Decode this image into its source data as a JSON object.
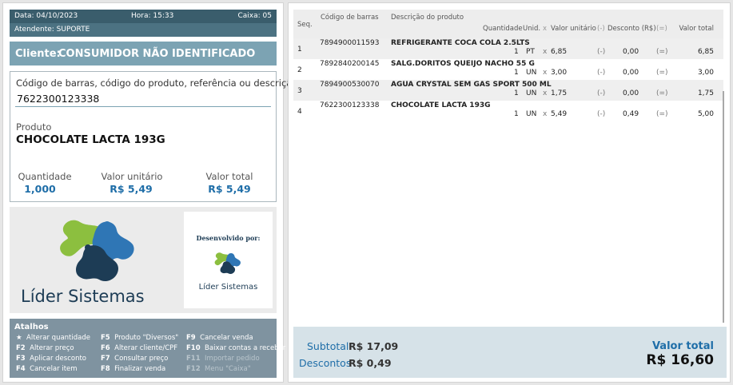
{
  "info": {
    "data": "Data:  04/10/2023",
    "hora": "Hora:  15:33",
    "caixa": "Caixa: 05",
    "atendente": "Atendente:  SUPORTE"
  },
  "client": {
    "label": "Cliente:",
    "name": "CONSUMIDOR NÃO IDENTIFICADO"
  },
  "entry": {
    "label": "Código de barras, código do produto, referência ou descrição",
    "value": "7622300123338",
    "produto_label": "Produto",
    "produto_name": "CHOCOLATE LACTA 193G",
    "qty_label": "Quantidade",
    "qty_value": "1,000",
    "vu_label": "Valor unitário",
    "vu_value": "R$ 5,49",
    "vt_label": "Valor total",
    "vt_value": "R$ 5,49"
  },
  "brand": {
    "dev_by": "Desenvolvido por:",
    "name": "Líder Sistemas",
    "colors": {
      "green": "#8cbf3f",
      "blue": "#2f76b5",
      "navy": "#1d3c55"
    }
  },
  "shortcuts": {
    "title": "Atalhos",
    "items": [
      {
        "key": "★",
        "label": "Alterar quantidade",
        "enabled": true
      },
      {
        "key": "F2",
        "label": "Alterar preço",
        "enabled": true
      },
      {
        "key": "F3",
        "label": "Aplicar desconto",
        "enabled": true
      },
      {
        "key": "F4",
        "label": "Cancelar item",
        "enabled": true
      },
      {
        "key": "F5",
        "label": "Produto \"Diversos\"",
        "enabled": true
      },
      {
        "key": "F6",
        "label": "Alterar cliente/CPF",
        "enabled": true
      },
      {
        "key": "F7",
        "label": "Consultar preço",
        "enabled": true
      },
      {
        "key": "F8",
        "label": "Finalizar venda",
        "enabled": true
      },
      {
        "key": "F9",
        "label": "Cancelar venda",
        "enabled": true
      },
      {
        "key": "F10",
        "label": "Baixar contas a receber",
        "enabled": true
      },
      {
        "key": "F11",
        "label": "Importar pedido",
        "enabled": false
      },
      {
        "key": "F12",
        "label": "Menu \"Caixa\"",
        "enabled": false
      }
    ]
  },
  "table": {
    "headers": {
      "seq": "Seq.",
      "barcode": "Código de barras",
      "desc": "Descrição do produto",
      "qty": "Quantidade",
      "unit": "Unid.",
      "x": "x",
      "vu": "Valor unitário",
      "minus": "(-)",
      "discount": "Desconto (R$)",
      "equals": "(=)",
      "total": "Valor total"
    },
    "rows": [
      {
        "seq": "1",
        "barcode": "7894900011593",
        "desc": "REFRIGERANTE COCA COLA 2.5LTS",
        "qty": "1",
        "unit": "PT",
        "x": "x",
        "vu": "6,85",
        "minus": "(-)",
        "discount": "0,00",
        "equals": "(=)",
        "total": "6,85"
      },
      {
        "seq": "2",
        "barcode": "7892840200145",
        "desc": "SALG.DORITOS QUEIJO NACHO 55 G",
        "qty": "1",
        "unit": "UN",
        "x": "x",
        "vu": "3,00",
        "minus": "(-)",
        "discount": "0,00",
        "equals": "(=)",
        "total": "3,00"
      },
      {
        "seq": "3",
        "barcode": "7894900530070",
        "desc": "AGUA CRYSTAL SEM GAS SPORT 500 ML",
        "qty": "1",
        "unit": "UN",
        "x": "x",
        "vu": "1,75",
        "minus": "(-)",
        "discount": "0,00",
        "equals": "(=)",
        "total": "1,75"
      },
      {
        "seq": "4",
        "barcode": "7622300123338",
        "desc": "CHOCOLATE LACTA 193G",
        "qty": "1",
        "unit": "UN",
        "x": "x",
        "vu": "5,49",
        "minus": "(-)",
        "discount": "0,49",
        "equals": "(=)",
        "total": "5,00"
      }
    ]
  },
  "totals": {
    "subtotal_label": "Subtotal",
    "subtotal_value": "R$ 17,09",
    "descontos_label": "Descontos",
    "descontos_value": "R$ 0,49",
    "total_label": "Valor total",
    "total_value": "R$ 16,60"
  }
}
